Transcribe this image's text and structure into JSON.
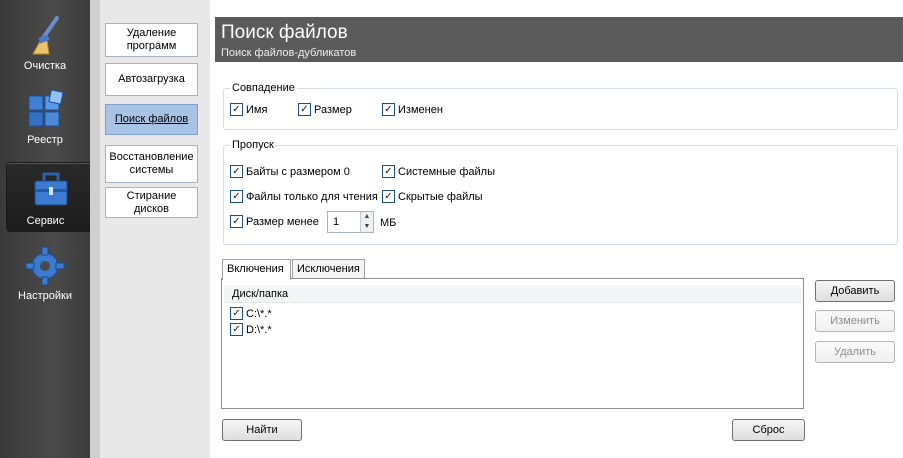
{
  "nav": [
    {
      "label": "Очистка",
      "icon": "broom-icon"
    },
    {
      "label": "Реестр",
      "icon": "registry-cubes-icon"
    },
    {
      "label": "Сервис",
      "icon": "toolbox-icon",
      "selected": true
    },
    {
      "label": "Настройки",
      "icon": "gear-icon"
    }
  ],
  "tools": {
    "uninstall": "Удаление программ",
    "startup": "Автозагрузка",
    "find_files": "Поиск файлов",
    "restore": "Восстановление системы",
    "wipe": "Стирание дисков"
  },
  "header": {
    "title": "Поиск файлов",
    "subtitle": "Поиск файлов-дубликатов"
  },
  "match": {
    "title": "Совпадение",
    "name": {
      "label": "Имя",
      "checked": true
    },
    "size": {
      "label": "Размер",
      "checked": true
    },
    "modified": {
      "label": "Изменен",
      "checked": true
    }
  },
  "skip": {
    "title": "Пропуск",
    "zero_bytes": {
      "label": "Байты с размером 0",
      "checked": true
    },
    "system": {
      "label": "Системные файлы",
      "checked": true
    },
    "readonly": {
      "label": "Файлы только для чтения",
      "checked": true
    },
    "hidden": {
      "label": "Скрытые файлы",
      "checked": true
    },
    "size_less": {
      "label": "Размер менее",
      "checked": true
    },
    "size_value": "1",
    "size_unit": "МБ"
  },
  "tabs": {
    "include": "Включения",
    "exclude": "Исключения"
  },
  "list": {
    "header": "Диск/папка",
    "rows": [
      {
        "path": "C:\\*.*",
        "checked": true
      },
      {
        "path": "D:\\*.*",
        "checked": true
      }
    ]
  },
  "buttons": {
    "add": "Добавить",
    "edit": "Изменить",
    "delete": "Удалить",
    "find": "Найти",
    "reset": "Сброс"
  }
}
